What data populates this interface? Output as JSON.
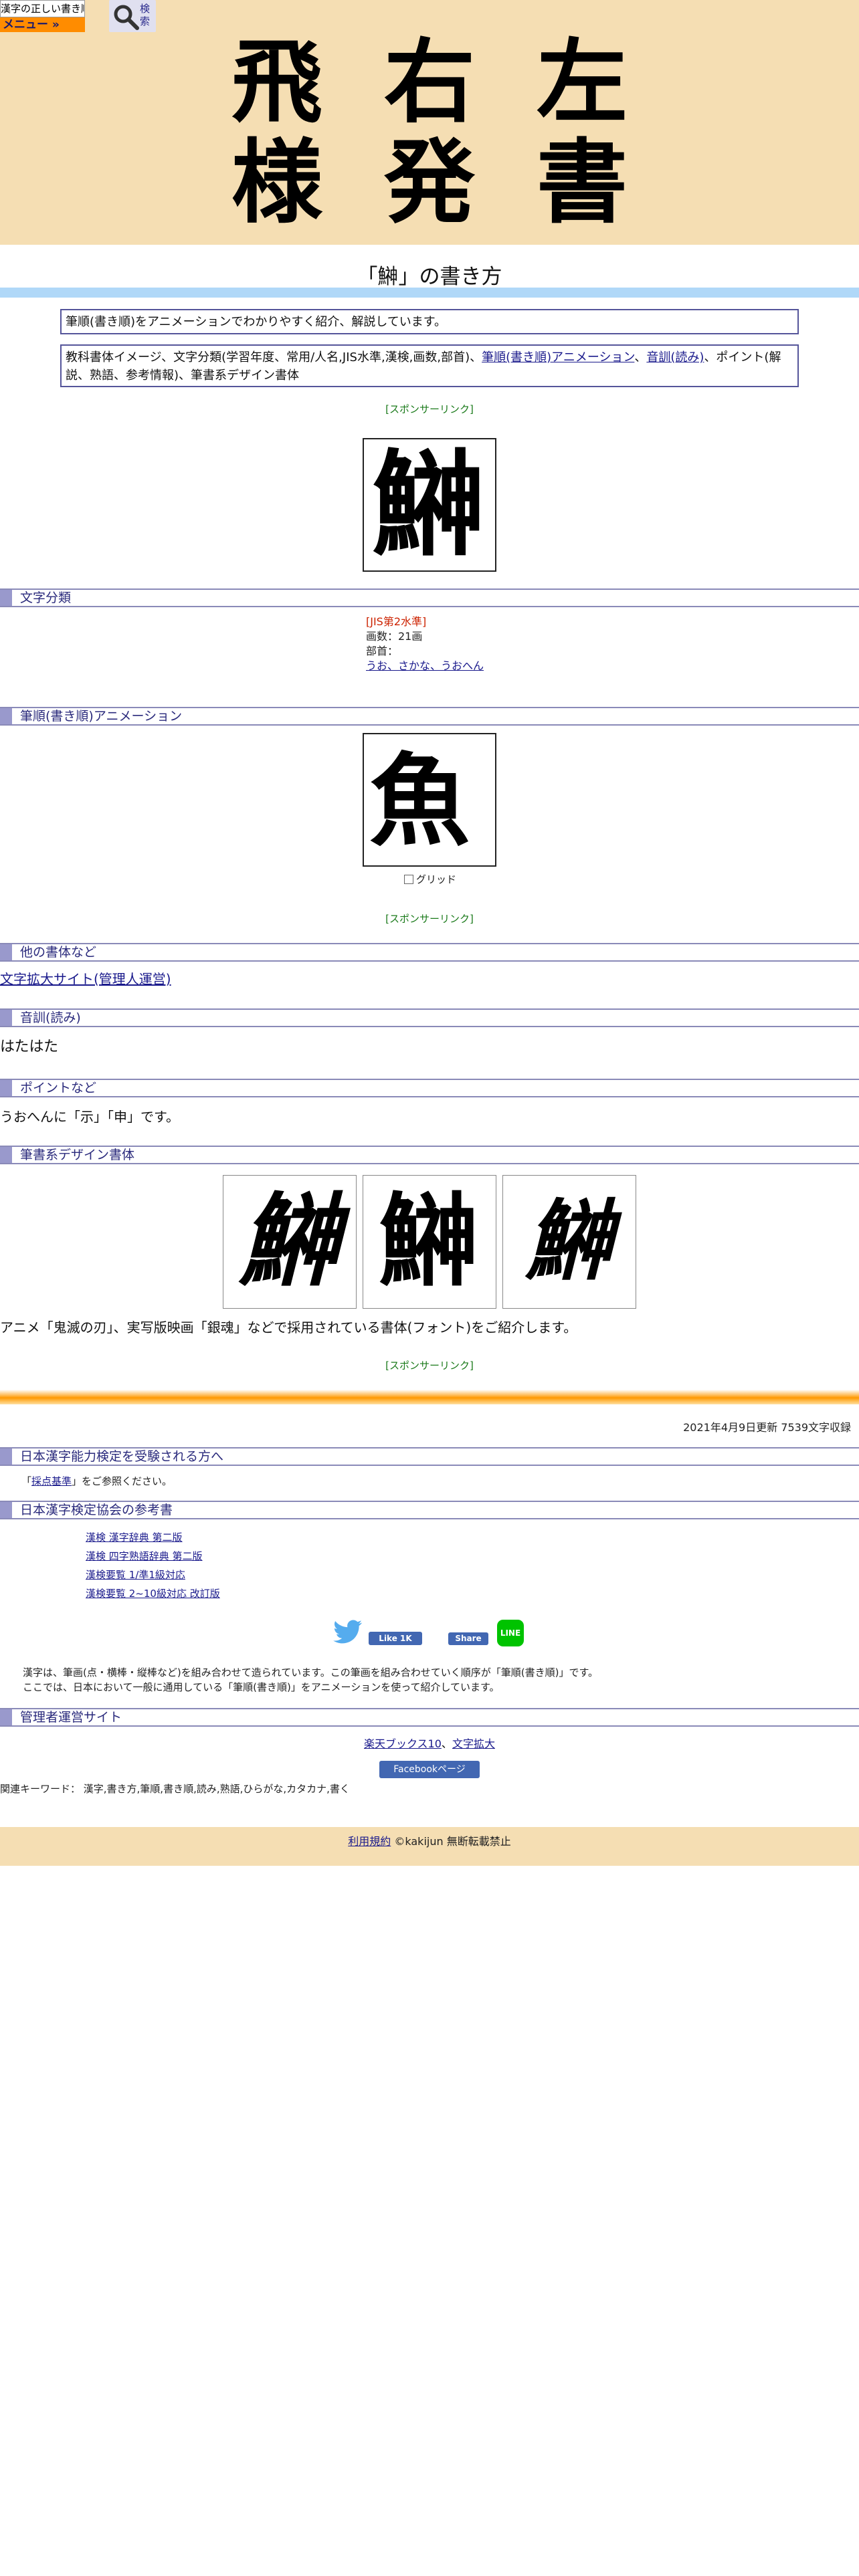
{
  "header": {
    "logo_text": "漢字の正しい書き順(筆順)",
    "menu_label": "メニュー »",
    "search_label": "検索",
    "title_chars": [
      "飛",
      "右",
      "左",
      "様",
      "発",
      "書"
    ]
  },
  "page_title": "「鰰」の書き方",
  "intro": {
    "line1": "筆順(書き順)をアニメーションでわかりやすく紹介、解説しています。",
    "line2_text": "教科書体イメージ、文字分類(学習年度、常用/人名,JIS水準,漢検,画数,部首)、",
    "line2_link1": "筆順(書き順)アニメーション",
    "line2_sep": "、",
    "line2_link2": "音訓(読み)",
    "line2_rest": "、ポイント(解説、熟語、参考情報)、筆書系デザイン書体"
  },
  "sponsor_label": "[スポンサーリンク]",
  "kanji": "鰰",
  "sections": {
    "classification": "文字分類",
    "animation": "筆順(書き順)アニメーション",
    "other_fonts": "他の書体など",
    "reading": "音訓(読み)",
    "point": "ポイントなど",
    "design_fonts": "筆書系デザイン書体",
    "kentei": "日本漢字能力検定を受験される方へ",
    "kentei_ref": "日本漢字検定協会の参考書",
    "admin": "管理者運営サイト"
  },
  "classification": {
    "jis_level": "[JIS第2水準]",
    "stroke_count": "画数：21画",
    "radical_label": "部首：",
    "radical_link": "うお、さかな、うおへん"
  },
  "animation": {
    "current_frame": "魚",
    "grid_label": "グリッド"
  },
  "other_fonts_link": "文字拡大サイト(管理人運営)",
  "reading_text": "はたはた",
  "point_text": "うおへんに「示」「申」です。",
  "design_caption": "アニメ「鬼滅の刃」、実写版映画「銀魂」などで採用されている書体(フォント)をご紹介します。",
  "updated": "2021年4月9日更新 7539文字収録",
  "kentei": {
    "text_pre": "「",
    "link": "採点基準",
    "text_post": "」をご参照ください。"
  },
  "ref_books": [
    "漢検 漢字辞典 第二版",
    "漢検 四字熟語辞典 第二版",
    "漢検要覧 1/準1級対応",
    "漢検要覧 2~10級対応 改訂版"
  ],
  "social": {
    "like_label": "Like 1K",
    "share_label": "Share",
    "line_label": "LINE"
  },
  "explain": {
    "line1": "漢字は、筆画(点・横棒・縦棒など)を組み合わせて造られています。この筆画を組み合わせていく順序が「筆順(書き順)」です。",
    "line2": "ここでは、日本において一般に通用している「筆順(書き順)」をアニメーションを使って紹介しています。"
  },
  "admin_sites": {
    "link1": "楽天ブックス10",
    "sep": "、",
    "link2": "文字拡大"
  },
  "facebook_page_label": "Facebookページ",
  "keywords": "関連キーワード： 漢字,書き方,筆順,書き順,読み,熟語,ひらがな,カタカナ,書く",
  "footer": {
    "terms_link": "利用規約",
    "copyright": "©kakijun 無断転載禁止"
  },
  "colors": {
    "header_bg": "#f5deb3",
    "menu_orange": "#ff8c00",
    "title_bar": "#b0d8f8",
    "section_marker": "#9999cc",
    "sponsor_green": "#1a7a1a",
    "facebook_blue": "#4267b2",
    "line_green": "#00c300"
  }
}
